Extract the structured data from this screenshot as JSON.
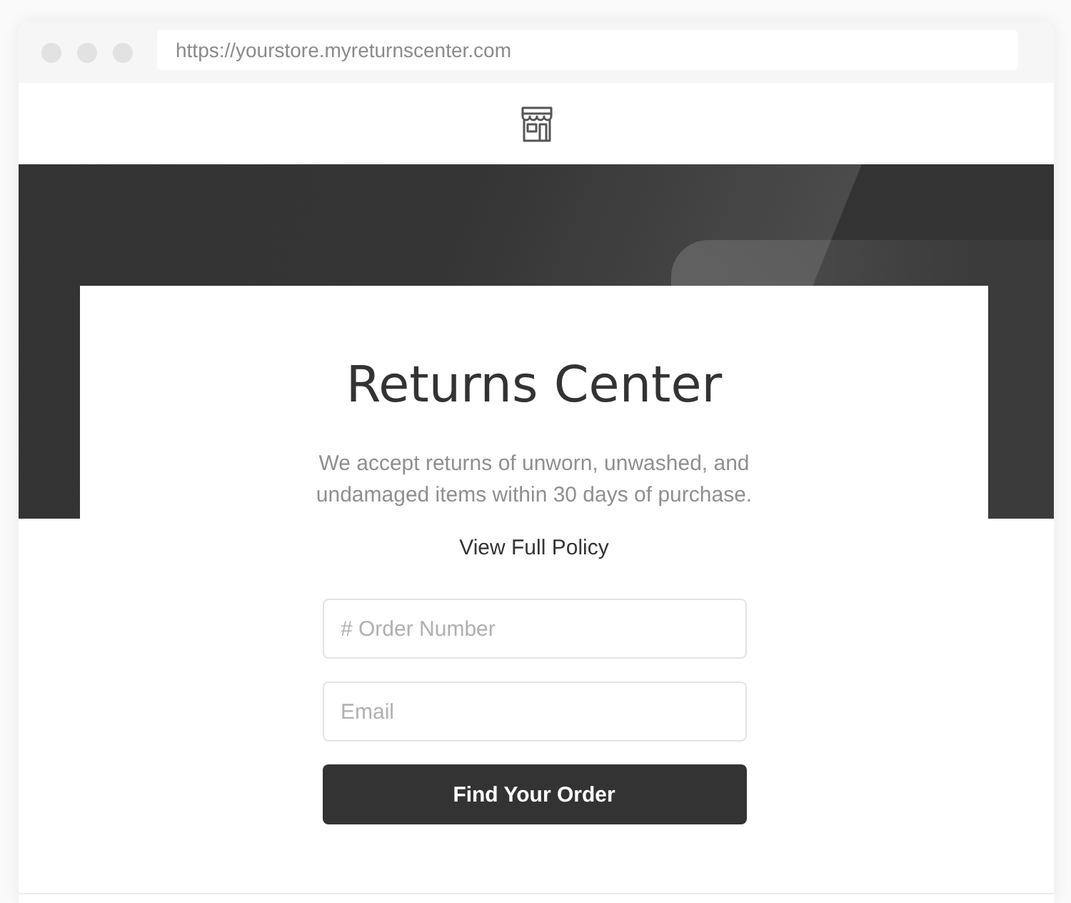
{
  "browser": {
    "url": "https://yourstore.myreturnscenter.com"
  },
  "hero": {
    "title": "Returns Center",
    "description": "We accept returns of unworn, unwashed, and undamaged items within 30 days of purchase.",
    "policy_link": "View Full Policy"
  },
  "form": {
    "fields": [
      {
        "placeholder": "# Order Number"
      },
      {
        "placeholder": "Email"
      }
    ],
    "button": "Find Your Order"
  }
}
